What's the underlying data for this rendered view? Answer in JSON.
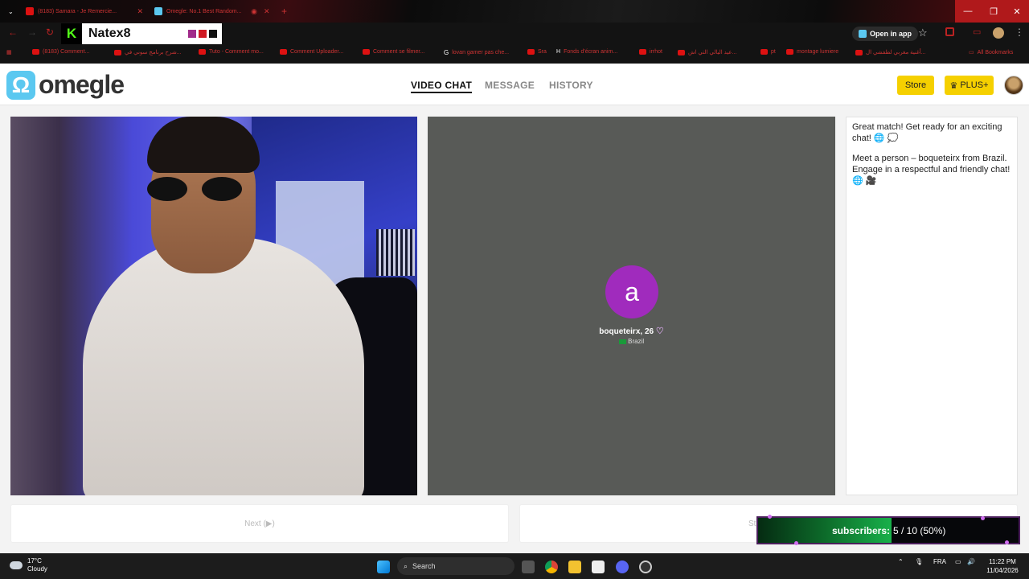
{
  "browser": {
    "tabs": [
      {
        "title": "(8183) Samara - Je Remercie...",
        "active": false
      },
      {
        "title": "Omegle: No.1 Best Random...",
        "active": true
      }
    ],
    "new_tab": "+",
    "overlay_channel": "Natex8",
    "open_in_app": "Open in app",
    "bookmarks": [
      "(8183) Comment...",
      "شرح برنامج سوني في...",
      "Tuto - Comment mo...",
      "Comment Uploader...",
      "Comment se filmer...",
      "lovan gamer pas che...",
      "Sra",
      "Fonds d'écran anim...",
      "irrhot",
      "عيد اليالي التي اش...",
      "pt",
      "montage lumiere",
      "أغنية مغربي لطفشي ال...",
      "All Bookmarks"
    ]
  },
  "site": {
    "logo_text": "omegle",
    "nav": {
      "video_chat": "VIDEO CHAT",
      "message": "MESSAGE",
      "history": "HISTORY"
    },
    "store_label": "Store",
    "plus_label": "PLUS+"
  },
  "peer": {
    "initial": "a",
    "name": "boqueteirx, 26",
    "country": "Brazil"
  },
  "chat": {
    "messages": [
      "Great match! Get ready for an exciting chat! 🌐 💭",
      "Meet a person – boqueteirx from Brazil. Engage in a respectful and friendly chat! 🌐 🎥"
    ]
  },
  "controls": {
    "next_label": "Next (▶)",
    "stop_label": "St"
  },
  "subgoal": {
    "label": "subscribers:",
    "value": "5 / 10 (50%)",
    "progress": 0.5
  },
  "taskbar": {
    "temp": "17°C",
    "condition": "Cloudy",
    "search": "Search",
    "lang": "FRA",
    "time": "11:22 PM",
    "date": "11/04/2026"
  }
}
